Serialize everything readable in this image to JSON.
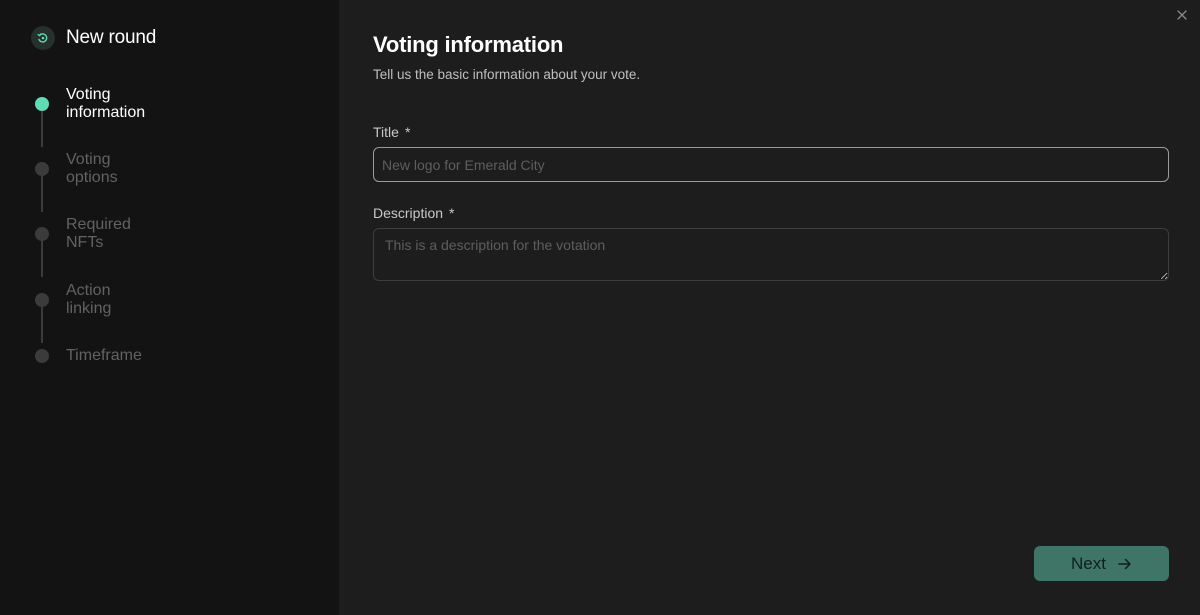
{
  "sidebar": {
    "title": "New round",
    "header_icon": "round-icon",
    "steps": [
      {
        "label": "Voting information",
        "active": true
      },
      {
        "label": "Voting options",
        "active": false
      },
      {
        "label": "Required NFTs",
        "active": false
      },
      {
        "label": "Action linking",
        "active": false
      },
      {
        "label": "Timeframe",
        "active": false
      }
    ]
  },
  "main": {
    "title": "Voting information",
    "subtitle": "Tell us the basic information about your vote.",
    "title_field": {
      "label": "Title",
      "required_mark": "*",
      "value": "",
      "placeholder": "New logo for Emerald City"
    },
    "description_field": {
      "label": "Description",
      "required_mark": "*",
      "value": "",
      "placeholder": "This is a description for the votation"
    },
    "next_button": {
      "label": "Next",
      "icon": "arrow-right-icon"
    },
    "close_icon": "close-icon"
  },
  "colors": {
    "accent": "#5fdcb3",
    "button_bg": "#3f7566",
    "sidebar_bg": "#131313",
    "main_bg": "#1d1d1d"
  }
}
